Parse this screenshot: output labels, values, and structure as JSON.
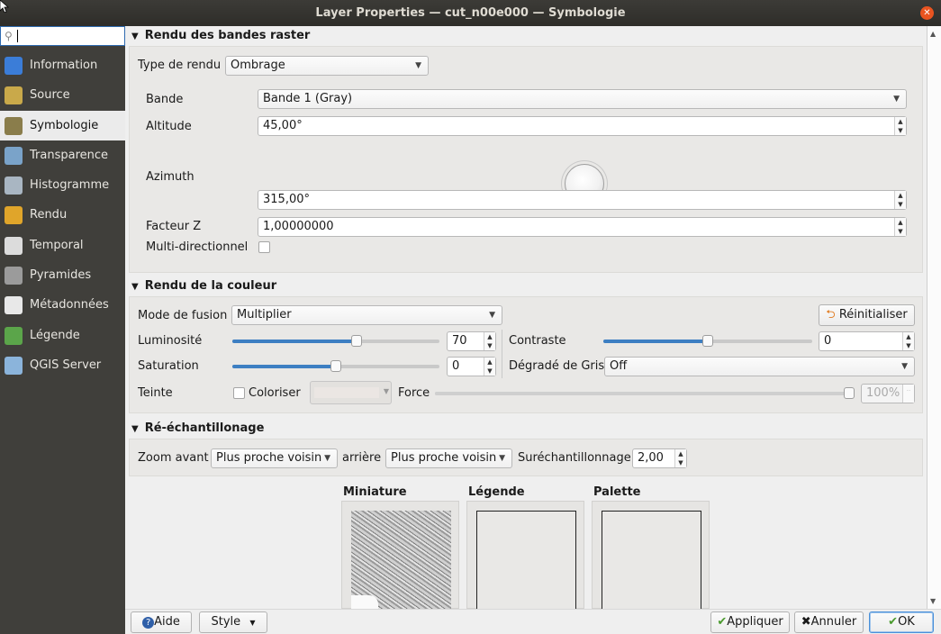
{
  "window": {
    "title": "Layer Properties — cut_n00e000 — Symbologie"
  },
  "search": {
    "value": ""
  },
  "sidebar": {
    "items": [
      {
        "label": "Information",
        "icon": "info-icon",
        "color": "#3b7dd8"
      },
      {
        "label": "Source",
        "icon": "source-icon",
        "color": "#c9a94a"
      },
      {
        "label": "Symbologie",
        "icon": "paintbrush-icon",
        "color": "#8a7d4b"
      },
      {
        "label": "Transparence",
        "icon": "transparency-icon",
        "color": "#7aa3c9"
      },
      {
        "label": "Histogramme",
        "icon": "histogram-icon",
        "color": "#a9b6c2"
      },
      {
        "label": "Rendu",
        "icon": "brush-icon",
        "color": "#e0a52a"
      },
      {
        "label": "Temporal",
        "icon": "clock-icon",
        "color": "#dcdcdc"
      },
      {
        "label": "Pyramides",
        "icon": "pyramid-icon",
        "color": "#9b9b9b"
      },
      {
        "label": "Métadonnées",
        "icon": "metadata-icon",
        "color": "#e8e8e8"
      },
      {
        "label": "Légende",
        "icon": "legend-icon",
        "color": "#5ba54a"
      },
      {
        "label": "QGIS Server",
        "icon": "server-icon",
        "color": "#8bb4db"
      }
    ],
    "active_index": 2
  },
  "raster": {
    "header": "Rendu des bandes raster",
    "render_type_label": "Type de rendu",
    "render_type_value": "Ombrage",
    "band_label": "Bande",
    "band_value": "Bande 1 (Gray)",
    "altitude_label": "Altitude",
    "altitude_value": "45,00°",
    "azimuth_label": "Azimuth",
    "azimuth_value": "315,00°",
    "zfactor_label": "Facteur Z",
    "zfactor_value": "1,00000000",
    "multidir_label": "Multi-directionnel",
    "multidir_checked": false
  },
  "color": {
    "header": "Rendu de la couleur",
    "blend_label": "Mode de fusion",
    "blend_value": "Multiplier",
    "reset_label": "Réinitialiser",
    "brightness_label": "Luminosité",
    "brightness_value": "70",
    "brightness_fraction": 0.6,
    "contrast_label": "Contraste",
    "contrast_value": "0",
    "contrast_fraction": 0.5,
    "saturation_label": "Saturation",
    "saturation_value": "0",
    "saturation_fraction": 0.5,
    "grayscale_label": "Dégradé de Gris",
    "grayscale_value": "Off",
    "hue_label": "Teinte",
    "colorize_label": "Coloriser",
    "colorize_checked": false,
    "force_label": "Force",
    "force_value": "100%",
    "force_fraction": 1.0
  },
  "resample": {
    "header": "Ré-échantillonage",
    "zoom_in_label": "Zoom avant",
    "zoom_in_value": "Plus proche voisin",
    "zoom_out_label": "arrière",
    "zoom_out_value": "Plus proche voisin",
    "oversample_label": "Suréchantillonnage",
    "oversample_value": "2,00"
  },
  "preview": {
    "thumbnail_label": "Miniature",
    "legend_label": "Légende",
    "palette_label": "Palette"
  },
  "footer": {
    "help_label": "Aide",
    "style_label": "Style",
    "apply_label": "Appliquer",
    "cancel_label": "Annuler",
    "ok_label": "OK"
  }
}
